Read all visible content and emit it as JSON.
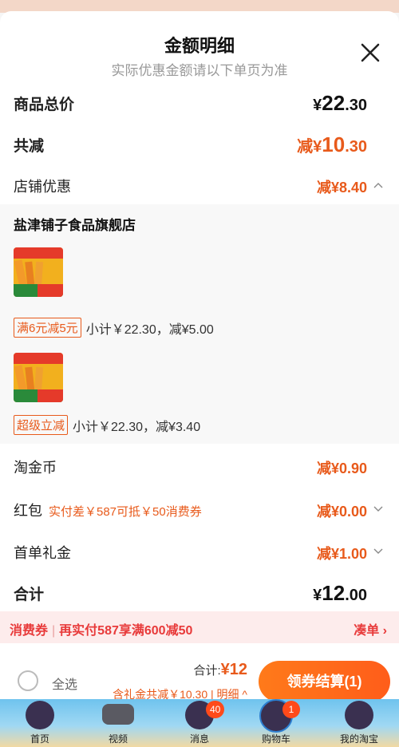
{
  "header": {
    "title": "金额明细",
    "subtitle": "实际优惠金额请以下单页为准"
  },
  "rows": {
    "goods_total": {
      "label": "商品总价",
      "currency": "¥",
      "int": "22",
      "dec": ".30"
    },
    "total_reduce": {
      "label": "共减",
      "prefix": "减¥",
      "int": "10",
      "dec": ".30"
    },
    "shop_discount": {
      "label": "店铺优惠",
      "value": "减¥8.40"
    },
    "coins": {
      "label": "淘金币",
      "value": "减¥0.90"
    },
    "red_packet": {
      "label": "红包",
      "hint": "实付差￥587可抵￥50消费券",
      "value": "减¥0.00"
    },
    "first_gift": {
      "label": "首单礼金",
      "value": "减¥1.00"
    },
    "sum": {
      "label": "合计",
      "currency": "¥",
      "int": "12",
      "dec": ".00"
    }
  },
  "shop": {
    "name": "盐津铺子食品旗舰店",
    "items": [
      {
        "tag": "满6元减5元",
        "text": "小计￥22.30，减¥5.00"
      },
      {
        "tag": "超级立减",
        "text": "小计￥22.30，减¥3.40"
      }
    ]
  },
  "coupon_bar": {
    "left_tag": "消费券",
    "left_text": "再实付587享满600减50",
    "right": "凑单"
  },
  "footer": {
    "select_all": "全选",
    "total_label": "合计:",
    "total_value": "¥12",
    "gift_text": "含礼金共减￥10.30 | 明细",
    "checkout": "领券结算(1)"
  },
  "tabbar": [
    {
      "label": "首页"
    },
    {
      "label": "视频"
    },
    {
      "label": "消息",
      "badge": "40"
    },
    {
      "label": "购物车",
      "badge": "1"
    },
    {
      "label": "我的淘宝"
    }
  ],
  "colors": {
    "accent": "#e85a1b",
    "coupon_red": "#e83a3a",
    "checkout": "#ff6a1a"
  }
}
